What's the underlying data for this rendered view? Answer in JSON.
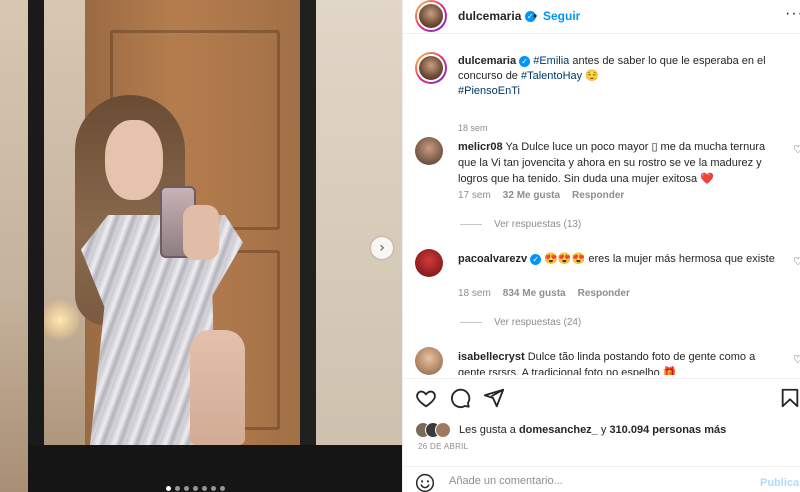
{
  "post": {
    "username": "dulcemaria",
    "follow_label": "Seguir",
    "dot": "•",
    "more": "···"
  },
  "caption": {
    "username": "dulcemaria",
    "tag1": "#Emilia",
    "text1": " antes de saber lo que le esperaba en el concurso de ",
    "tag2": "#TalentoHay",
    "emoji": " 😌",
    "tag3": "#PiensoEnTi",
    "time": "18 sem"
  },
  "comments": [
    {
      "username": "melicr08",
      "text": " Ya Dulce luce un poco mayor ▯ me da mucha ternura que la Vi tan jovencita y ahora en su rostro se ve la madurez y logros que ha tenido. Sin duda una mujer exitosa ❤️",
      "time": "17 sem",
      "likes": "32 Me gusta",
      "reply": "Responder",
      "replies": "Ver respuestas (13)"
    },
    {
      "username": "pacoalvarezv",
      "text": " 😍😍😍 eres la mujer más hermosa que existe",
      "time": "18 sem",
      "likes": "834 Me gusta",
      "reply": "Responder",
      "replies": "Ver respuestas (24)"
    },
    {
      "username": "isabellecryst",
      "text": " Dulce tão linda postando foto de gente como a gente rsrsrs. A tradicional foto no espelho 🎁"
    }
  ],
  "likes": {
    "prefix": "Les gusta a ",
    "user": "domesanchez_",
    "middle": " y ",
    "count": "310.094 personas más"
  },
  "date": "26 DE ABRIL",
  "comment_box": {
    "placeholder": "Añade un comentario...",
    "publish": "Publicar"
  },
  "icons": [
    "heart-icon",
    "comment-icon",
    "share-icon",
    "bookmark-icon",
    "emoji-icon",
    "chevron-right-icon"
  ],
  "colors": {
    "accent": "#0095f6",
    "tag": "#00376b",
    "muted": "#8e8e8e"
  },
  "carousel": {
    "slides": 7,
    "active_index": 0
  }
}
